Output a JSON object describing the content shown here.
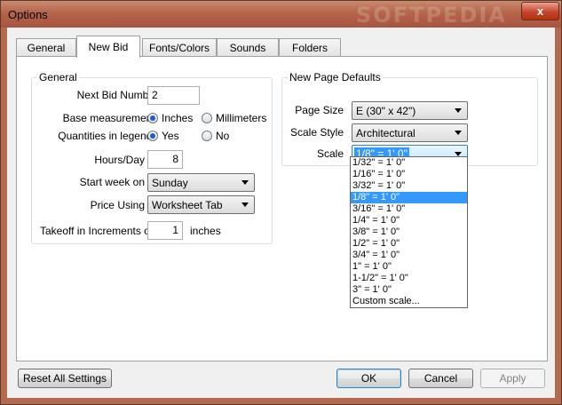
{
  "window": {
    "title": "Options",
    "watermark": "SOFTPEDIA",
    "close_glyph": "x"
  },
  "tabs": [
    {
      "label": "General"
    },
    {
      "label": "New Bid"
    },
    {
      "label": "Fonts/Colors"
    },
    {
      "label": "Sounds"
    },
    {
      "label": "Folders"
    }
  ],
  "active_tab": "New Bid",
  "general": {
    "group_label": "General",
    "next_bid_label": "Next Bid Number",
    "next_bid_value": "2",
    "base_measurement_label": "Base measurement:",
    "base_inches_label": "Inches",
    "base_mm_label": "Millimeters",
    "base_selected": "Inches",
    "quantities_label": "Quantities in legend?",
    "quantities_yes_label": "Yes",
    "quantities_no_label": "No",
    "quantities_selected": "Yes",
    "hours_label": "Hours/Day",
    "hours_value": "8",
    "start_week_label": "Start week on",
    "start_week_value": "Sunday",
    "price_using_label": "Price Using",
    "price_using_value": "Worksheet Tab",
    "takeoff_label": "Takeoff in Increments of",
    "takeoff_value": "1",
    "takeoff_unit": "inches"
  },
  "page_defaults": {
    "group_label": "New Page Defaults",
    "page_size_label": "Page Size",
    "page_size_value": "E (30\" x 42\")",
    "scale_style_label": "Scale Style",
    "scale_style_value": "Architectural",
    "scale_label": "Scale",
    "scale_value": "1/8\" = 1' 0\"",
    "scale_options": [
      "1/32\" = 1' 0\"",
      "1/16\" = 1' 0\"",
      "3/32\" = 1' 0\"",
      "1/8\" = 1' 0\"",
      "3/16\" = 1' 0\"",
      "1/4\" = 1' 0\"",
      "3/8\" = 1' 0\"",
      "1/2\" = 1' 0\"",
      "3/4\" = 1' 0\"",
      "1\" = 1' 0\"",
      "1-1/2\" = 1' 0\"",
      "3\" = 1' 0\"",
      "Custom scale..."
    ],
    "scale_highlighted_index": 3
  },
  "footer": {
    "reset_label": "Reset All Settings",
    "ok_label": "OK",
    "cancel_label": "Cancel",
    "apply_label": "Apply"
  },
  "colors": {
    "titlebar": "#b5654a",
    "selection": "#3399ff",
    "radio_dot": "#1a5dcb"
  }
}
